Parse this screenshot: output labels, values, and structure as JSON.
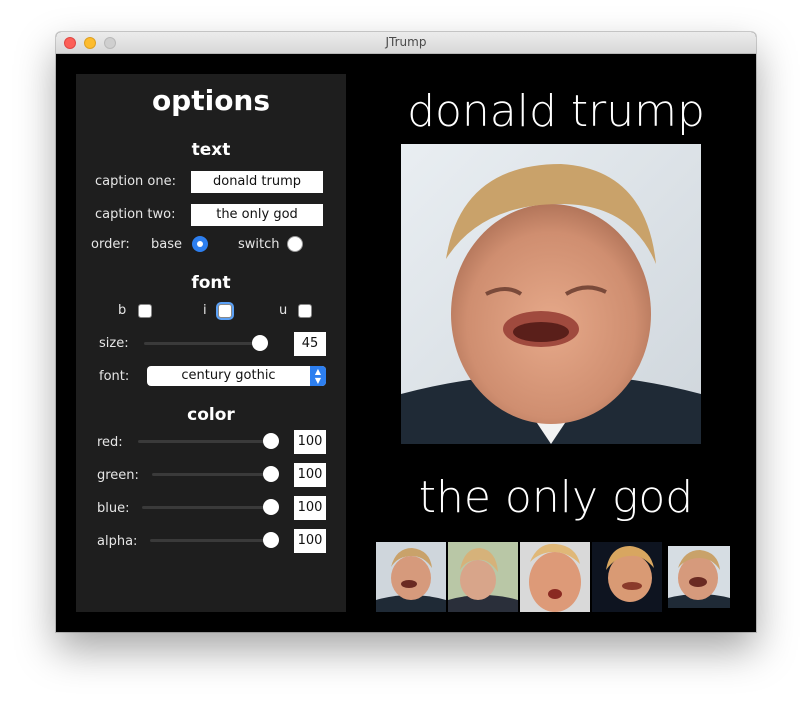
{
  "window": {
    "title": "JTrump"
  },
  "panel": {
    "title": "options",
    "text_section": {
      "heading": "text",
      "caption_one_label": "caption one:",
      "caption_one_value": "donald trump",
      "caption_two_label": "caption two:",
      "caption_two_value": "the only god",
      "order_label": "order:",
      "order_options": [
        {
          "label": "base",
          "selected": true
        },
        {
          "label": "switch",
          "selected": false
        }
      ]
    },
    "font_section": {
      "heading": "font",
      "bold_label": "b",
      "italic_label": "i",
      "underline_label": "u",
      "size_label": "size:",
      "size_value": "45",
      "font_label": "font:",
      "font_value": "century gothic"
    },
    "color_section": {
      "heading": "color",
      "sliders": [
        {
          "label": "red:",
          "value": "100"
        },
        {
          "label": "green:",
          "value": "100"
        },
        {
          "label": "blue:",
          "value": "100"
        },
        {
          "label": "alpha:",
          "value": "100"
        }
      ]
    }
  },
  "preview": {
    "caption_top": "donald trump",
    "caption_bottom": "the only god"
  },
  "colors": {
    "accent": "#2d7ff0",
    "panel_bg": "#1e1e1e",
    "window_bg": "#000000"
  }
}
